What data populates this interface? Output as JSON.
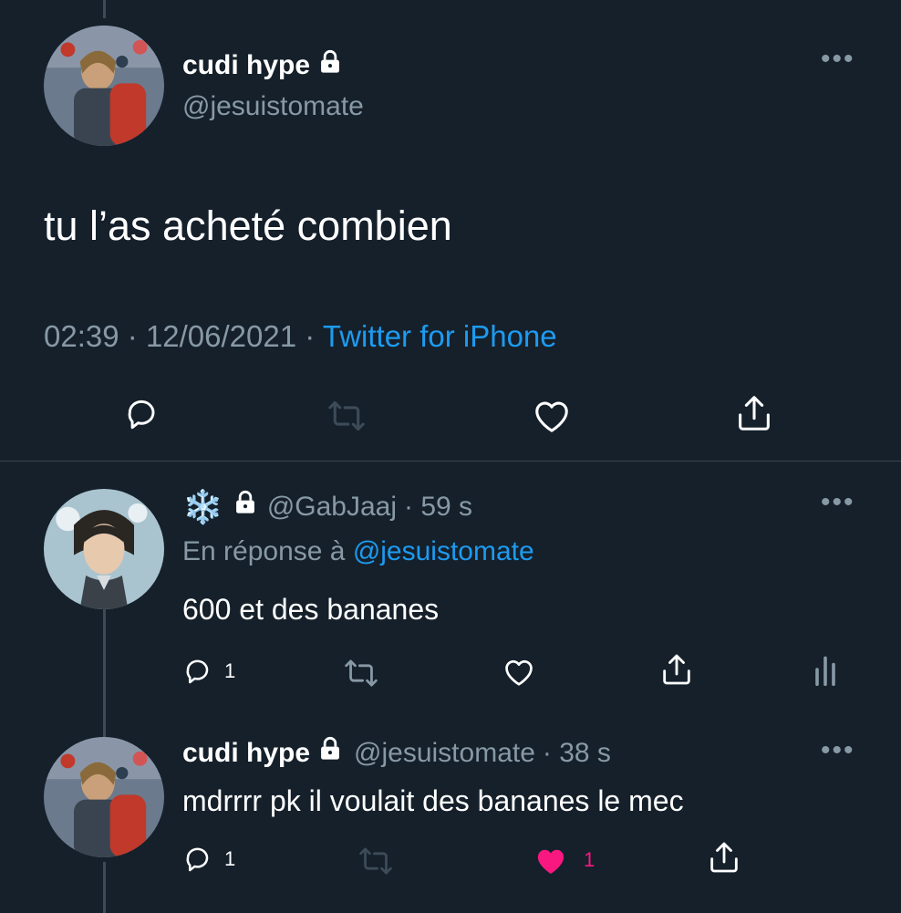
{
  "main_tweet": {
    "author_name": "cudi hype",
    "author_handle": "@jesuistomate",
    "text": "tu l’as acheté combien",
    "time": "02:39",
    "date": "12/06/2021",
    "source": "Twitter for iPhone",
    "sep1": "·",
    "sep2": "·",
    "icons": [
      "lock-icon",
      "more-icon",
      "reply-icon",
      "retweet-icon",
      "like-icon",
      "share-icon"
    ]
  },
  "reply1": {
    "display_emoji": "❄️",
    "handle": "@GabJaaj",
    "time": "· 59 s",
    "in_reply_prefix": "En réponse à",
    "in_reply_handle": "@jesuistomate",
    "text": "600 et des bananes",
    "reply_count": "1",
    "icons": [
      "lock-icon",
      "more-icon",
      "reply-icon",
      "retweet-icon",
      "like-icon",
      "share-icon",
      "analytics-icon"
    ]
  },
  "reply2": {
    "author_name": "cudi hype",
    "handle": "@jesuistomate",
    "time": "· 38 s",
    "text": "mdrrrr pk il voulait des bananes le mec",
    "reply_count": "1",
    "like_count": "1",
    "icons": [
      "lock-icon",
      "more-icon",
      "reply-icon",
      "retweet-icon",
      "like-filled-icon",
      "share-icon"
    ]
  },
  "colors": {
    "background": "#15202b",
    "muted": "#8899a6",
    "link": "#1d9bf0",
    "like": "#f91880"
  }
}
